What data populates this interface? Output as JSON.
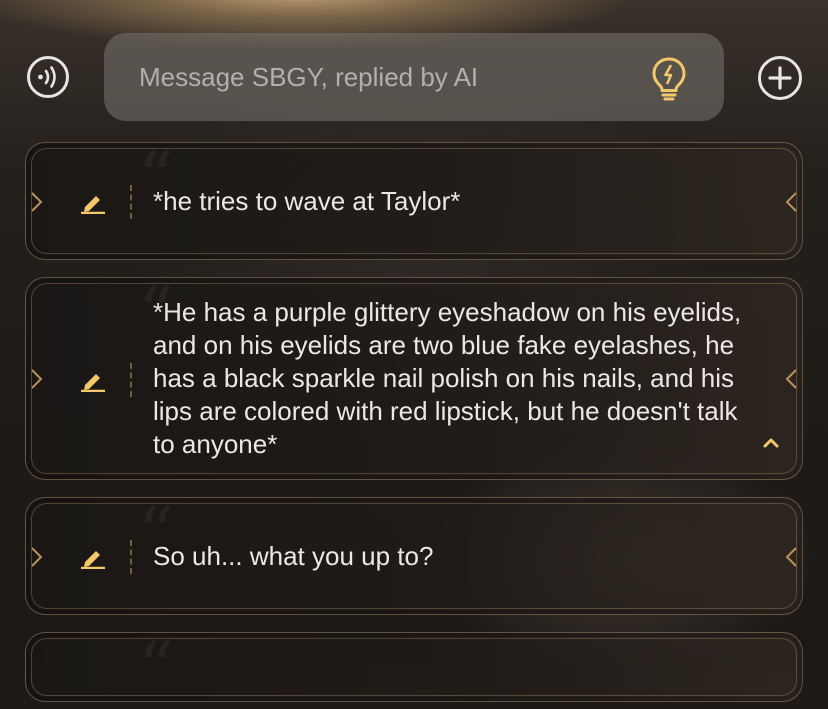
{
  "header": {
    "voice_button_icon": "voice-waves-icon",
    "message_placeholder": "Message SBGY, replied by AI",
    "hint_icon": "lightbulb-icon",
    "add_button_icon": "plus-circle-icon"
  },
  "messages": [
    {
      "text": "*he tries to wave at Taylor*"
    },
    {
      "text": "*He has a purple glittery eyeshadow on his eyelids, and on his eyelids are two blue fake eyelashes, he has a black sparkle nail polish on his nails, and his lips are colored with red lipstick, but he doesn't talk to anyone*",
      "expanded": true
    },
    {
      "text": "So uh... what you up to?"
    }
  ],
  "colors": {
    "accent_gold": "#f2c86a",
    "text": "#ece8e3",
    "placeholder": "#b3afaa"
  }
}
